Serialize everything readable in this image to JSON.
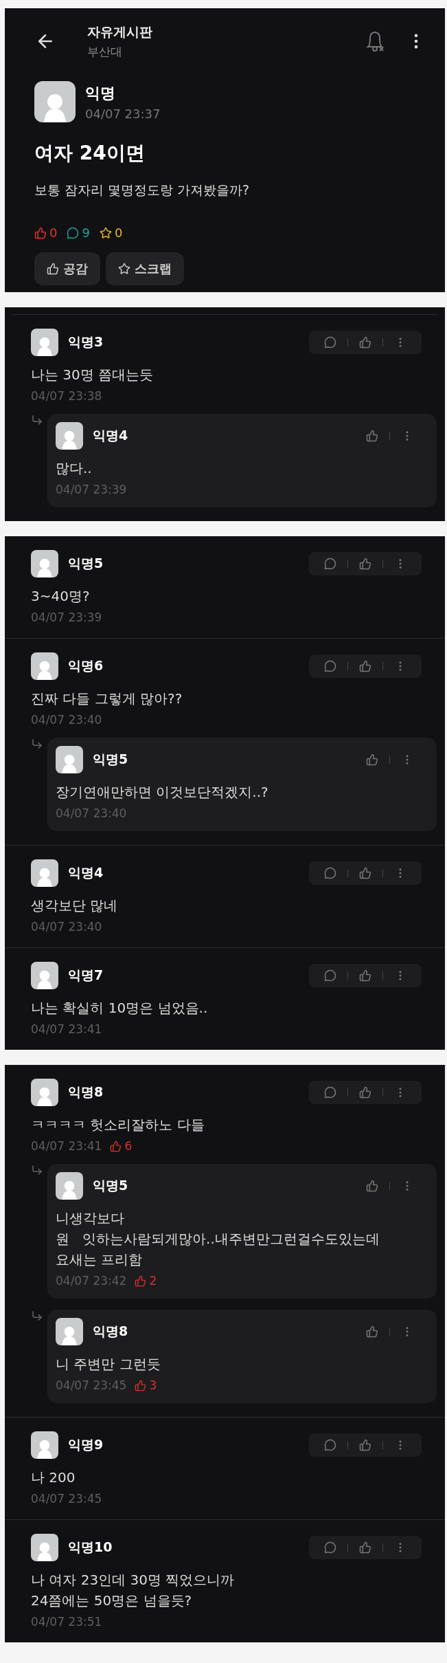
{
  "header": {
    "board_title": "자유게시판",
    "school": "부산대"
  },
  "post": {
    "author": "익명",
    "time": "04/07 23:37",
    "title": "여자 24이면",
    "body": "보통 잠자리 몇명정도랑 가져봤을까?",
    "counts": [
      {
        "kind": "like",
        "value": "0"
      },
      {
        "kind": "comment",
        "value": "9"
      },
      {
        "kind": "scrap",
        "value": "0"
      }
    ],
    "buttons": [
      {
        "kind": "like",
        "label": "공감"
      },
      {
        "kind": "scrap",
        "label": "스크랩"
      }
    ]
  },
  "panels": [
    {
      "top_divider": true,
      "comments": [
        {
          "author": "익명3",
          "text": "나는 30명 쯤대는듯",
          "time": "04/07 23:38",
          "replies": [
            {
              "author": "익명4",
              "text": "많다..",
              "time": "04/07 23:39"
            }
          ]
        }
      ]
    },
    {
      "top_divider": false,
      "comments": [
        {
          "author": "익명5",
          "text": "3~40명?",
          "time": "04/07 23:39"
        },
        {
          "author": "익명6",
          "text": "진짜 다들 그렇게 많아??",
          "time": "04/07 23:40",
          "replies": [
            {
              "author": "익명5",
              "text": "장기연애만하면 이것보단적겠지..?",
              "time": "04/07 23:40"
            }
          ]
        },
        {
          "author": "익명4",
          "text": "생각보단 많네",
          "time": "04/07 23:40"
        },
        {
          "author": "익명7",
          "text": "나는 확실히 10명은 넘었음..",
          "time": "04/07 23:41"
        }
      ]
    },
    {
      "top_divider": false,
      "comments": [
        {
          "author": "익명8",
          "text": "ㅋㅋㅋㅋ 헛소리잘하노 다들",
          "time": "04/07 23:41",
          "likes": "6",
          "replies": [
            {
              "author": "익명5",
              "text": "니생각보다\n원   잇하는사람되게많아..내주변만그런걸수도있는데\n요새는 프리함",
              "time": "04/07 23:42",
              "likes": "2"
            },
            {
              "author": "익명8",
              "text": "니 주변만 그런듯",
              "time": "04/07 23:45",
              "likes": "3"
            }
          ]
        },
        {
          "author": "익명9",
          "text": "나 200",
          "time": "04/07 23:45"
        },
        {
          "author": "익명10",
          "text": "나 여자 23인데 30명 찍었으니까\n24쯤에는 50명은 넘을듯?",
          "time": "04/07 23:51"
        }
      ]
    }
  ]
}
